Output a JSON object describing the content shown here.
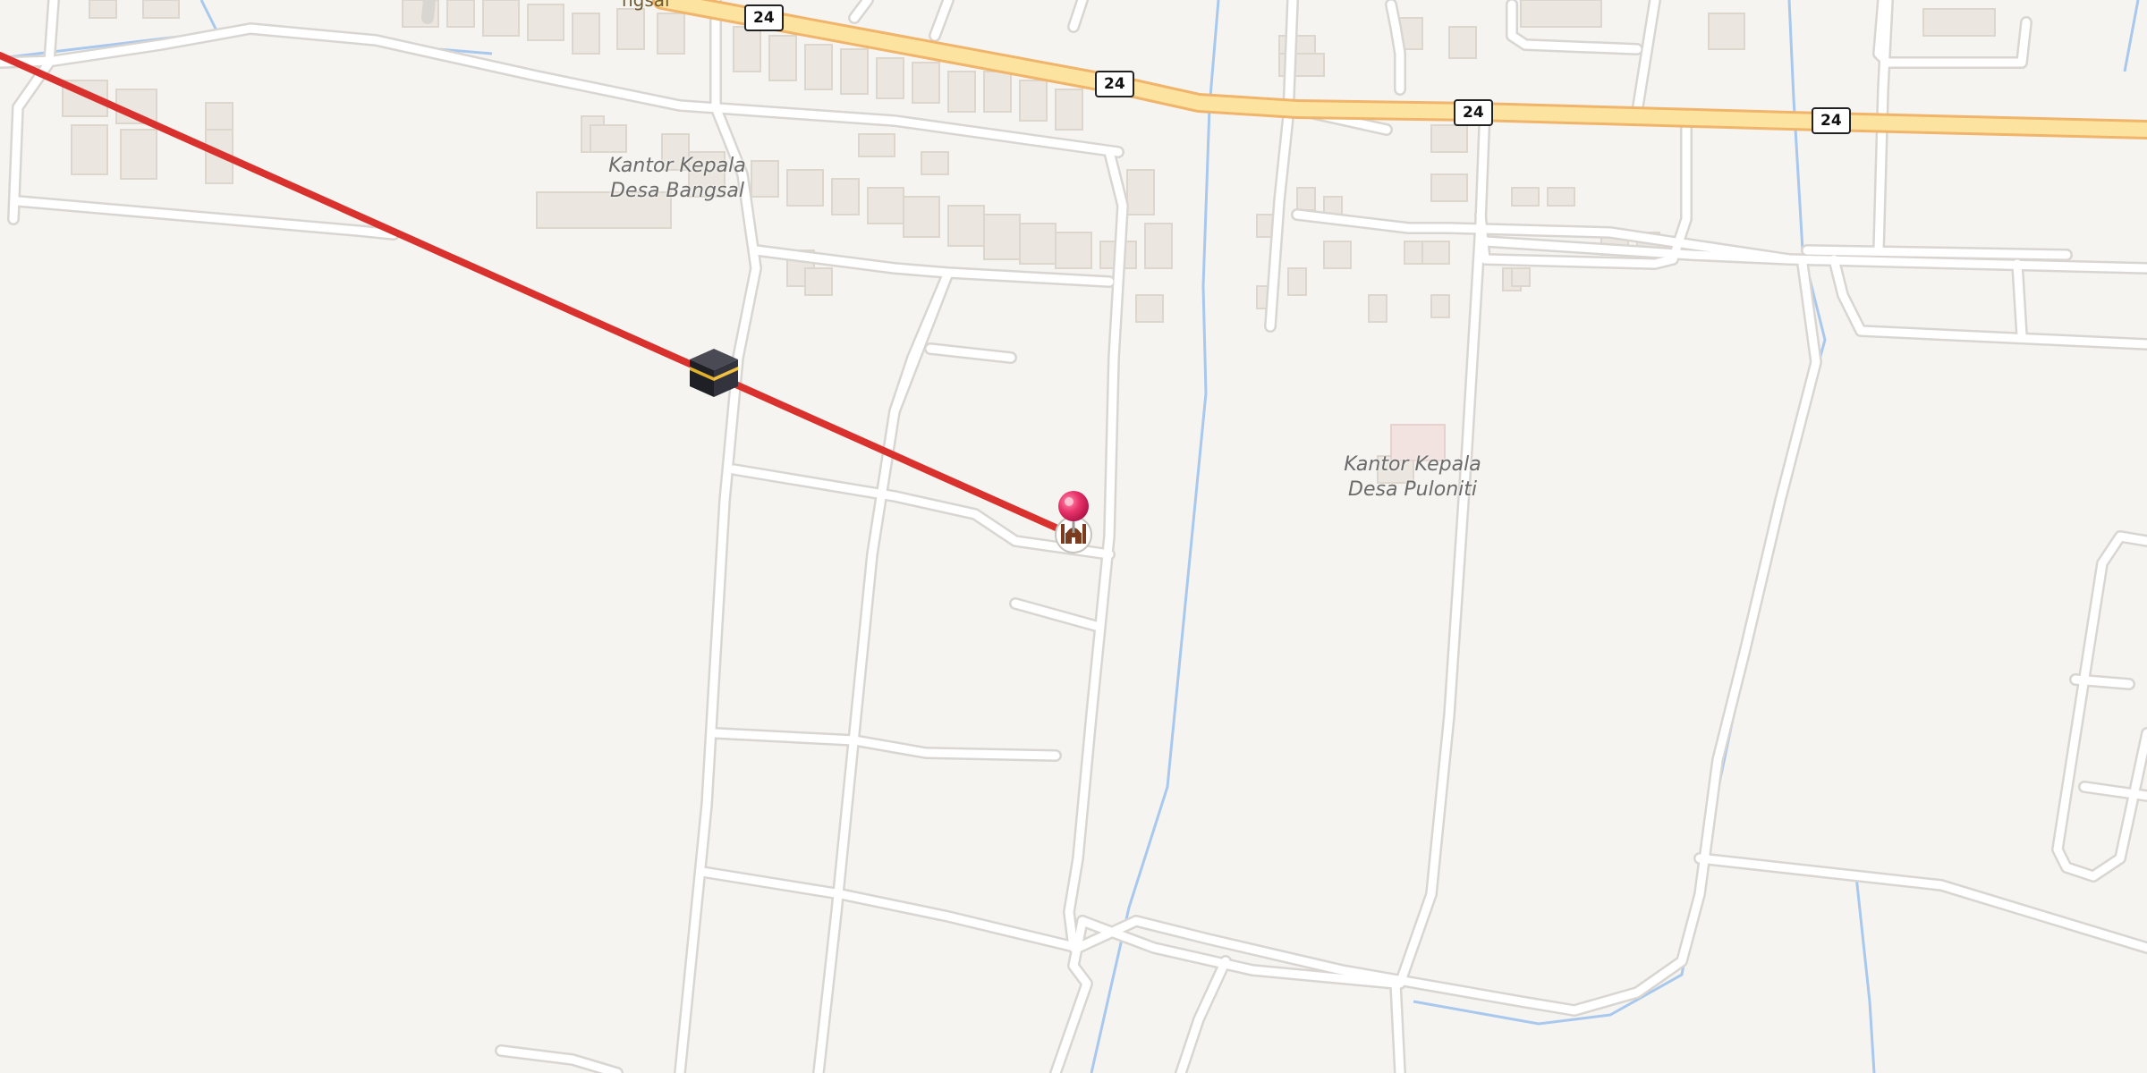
{
  "map": {
    "place_labels": [
      {
        "id": "bangsal",
        "lines": [
          "Kantor Kepala",
          "Desa Bangsal"
        ]
      },
      {
        "id": "puloniti",
        "lines": [
          "Kantor Kepala",
          "Desa Puloniti"
        ]
      }
    ],
    "road_partial_label": "ngsal",
    "route_shields": [
      "24",
      "24",
      "24",
      "24"
    ],
    "markers": {
      "kaaba": "kaaba-icon",
      "location_pin": "location-pin-icon",
      "mosque": "mosque-icon"
    },
    "colors": {
      "background": "#f6f4f1",
      "road": "#ffffff",
      "road_casing": "#d9d6d2",
      "main_road": "#fce3a0",
      "main_road_casing": "#f0b46a",
      "water": "#a8c8ee",
      "buildings": "#ebe6df",
      "qibla_line": "#d9322e",
      "pin": "#e8336a"
    }
  }
}
